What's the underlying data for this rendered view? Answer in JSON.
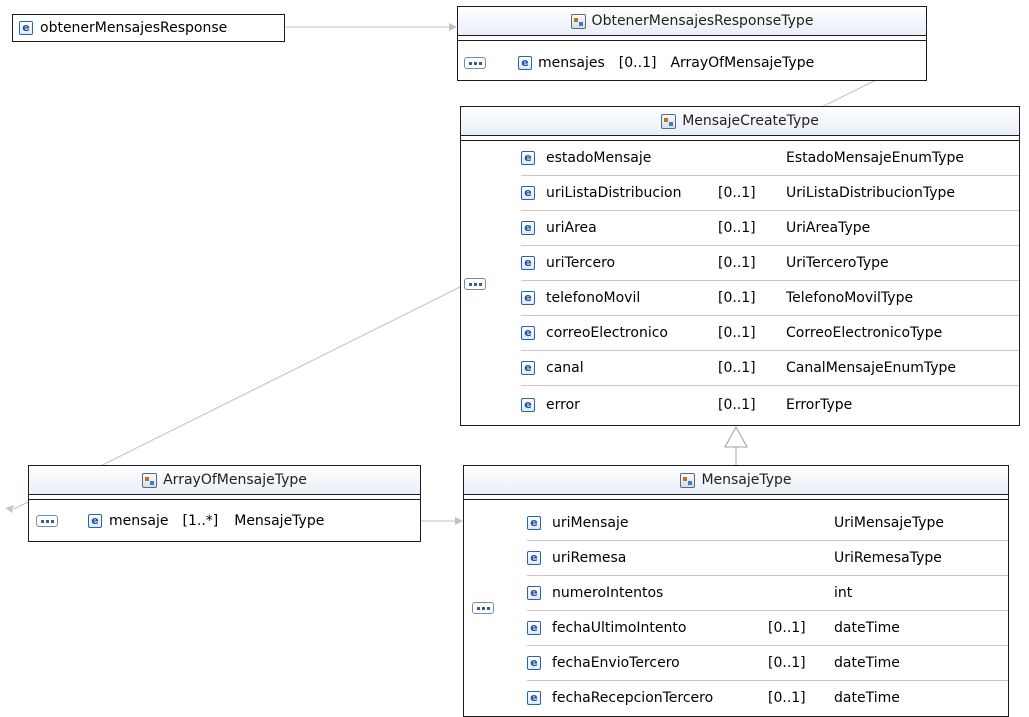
{
  "root_element": {
    "name": "obtenerMensajesResponse"
  },
  "obtener_type": {
    "title": "ObtenerMensajesResponseType",
    "elements": [
      {
        "name": "mensajes",
        "cardinality": "[0..1]",
        "type": "ArrayOfMensajeType"
      }
    ]
  },
  "mensaje_create_type": {
    "title": "MensajeCreateType",
    "elements": [
      {
        "name": "estadoMensaje",
        "cardinality": "",
        "type": "EstadoMensajeEnumType"
      },
      {
        "name": "uriListaDistribucion",
        "cardinality": "[0..1]",
        "type": "UriListaDistribucionType"
      },
      {
        "name": "uriArea",
        "cardinality": "[0..1]",
        "type": "UriAreaType"
      },
      {
        "name": "uriTercero",
        "cardinality": "[0..1]",
        "type": "UriTerceroType"
      },
      {
        "name": "telefonoMovil",
        "cardinality": "[0..1]",
        "type": "TelefonoMovilType"
      },
      {
        "name": "correoElectronico",
        "cardinality": "[0..1]",
        "type": "CorreoElectronicoType"
      },
      {
        "name": "canal",
        "cardinality": "[0..1]",
        "type": "CanalMensajeEnumType"
      },
      {
        "name": "error",
        "cardinality": "[0..1]",
        "type": "ErrorType"
      }
    ]
  },
  "array_type": {
    "title": "ArrayOfMensajeType",
    "elements": [
      {
        "name": "mensaje",
        "cardinality": "[1..*]",
        "type": "MensajeType"
      }
    ]
  },
  "mensaje_type": {
    "title": "MensajeType",
    "elements": [
      {
        "name": "uriMensaje",
        "cardinality": "",
        "type": "UriMensajeType"
      },
      {
        "name": "uriRemesa",
        "cardinality": "",
        "type": "UriRemesaType"
      },
      {
        "name": "numeroIntentos",
        "cardinality": "",
        "type": "int"
      },
      {
        "name": "fechaUltimoIntento",
        "cardinality": "[0..1]",
        "type": "dateTime"
      },
      {
        "name": "fechaEnvioTercero",
        "cardinality": "[0..1]",
        "type": "dateTime"
      },
      {
        "name": "fechaRecepcionTercero",
        "cardinality": "[0..1]",
        "type": "dateTime"
      }
    ]
  },
  "icons": {
    "element": "e",
    "complex_type": "complex-type-icon",
    "sequence": "sequence-icon"
  },
  "colors": {
    "border": "#1c1c1c",
    "connector": "#c0c0c0",
    "title_gradient": "#e9eef8",
    "icon_blue": "#1d4fa6"
  }
}
